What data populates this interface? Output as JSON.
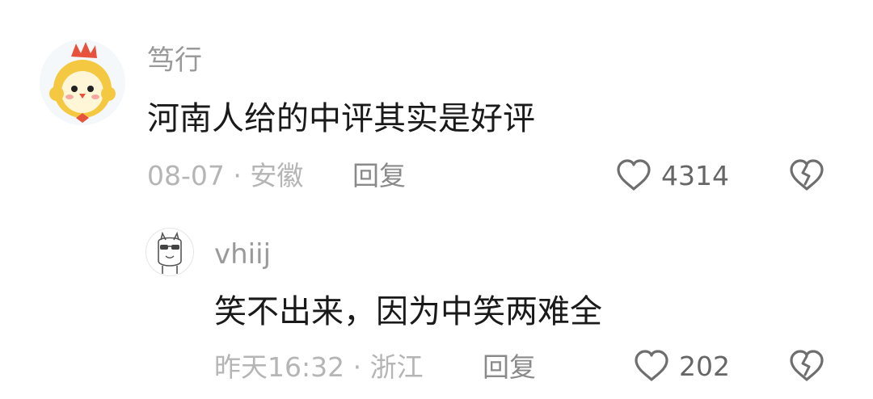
{
  "comments": [
    {
      "username": "笃行",
      "text": "河南人给的中评其实是好评",
      "date": "08-07",
      "sep": "·",
      "location": "安徽",
      "reply_label": "回复",
      "likes": "4314",
      "avatar_icon": "chick-hat-avatar-icon"
    }
  ],
  "replies": [
    {
      "username": "vhiij",
      "text": "笑不出来，因为中笑两难全",
      "date": "昨天16:32",
      "sep": "·",
      "location": "浙江",
      "reply_label": "回复",
      "likes": "202",
      "avatar_icon": "sketch-llama-avatar-icon"
    }
  ],
  "colors": {
    "username": "#9a9a9a",
    "text": "#1a1a1a",
    "meta": "#b5b5b5",
    "icon": "#6e6e6e"
  },
  "icons": {
    "like": "heart-outline-icon",
    "dislike": "broken-heart-icon"
  }
}
